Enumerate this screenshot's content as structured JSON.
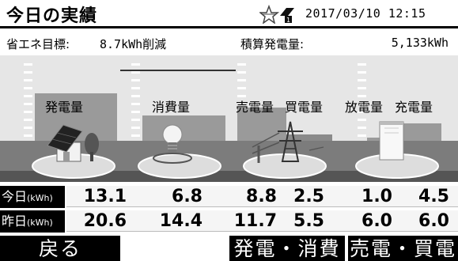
{
  "header": {
    "title": "今日の実績",
    "datetime": "2017/03/10 12:15"
  },
  "info": {
    "goal_label": "省エネ目標:",
    "goal_value": "8.7kWh削減",
    "generated_total_label": "積算発電量:",
    "generated_total_value": "5,133kWh"
  },
  "scene": {
    "labels": {
      "generation": "発電量",
      "consumption": "消費量",
      "sold": "売電量",
      "bought": "買電量",
      "discharge": "放電量",
      "charge": "充電量"
    },
    "icons": [
      "house-solar-icon",
      "lightbulb-icon",
      "power-tower-icon",
      "storage-battery-icon"
    ]
  },
  "table": {
    "today_label": "今日",
    "yesterday_label": "昨日",
    "unit": "(kWh)",
    "today": [
      "13.1",
      "6.8",
      "8.8",
      "2.5",
      "1.0",
      "4.5"
    ],
    "yesterday": [
      "20.6",
      "14.4",
      "11.7",
      "5.5",
      "6.0",
      "6.0"
    ]
  },
  "footer": {
    "back": "戻る",
    "gen_consume": "発電・消費",
    "sell_buy": "売電・買電"
  },
  "colors": {
    "bar": "#9a9a9a",
    "ground": "#7c7c7c",
    "header_bar": "#000000"
  }
}
